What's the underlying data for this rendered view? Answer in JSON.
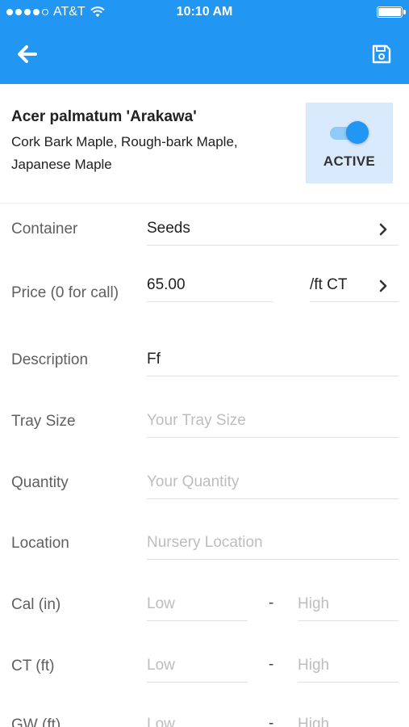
{
  "status_bar": {
    "carrier": "AT&T",
    "time": "10:10 AM"
  },
  "app_bar": {
    "back_icon": "back-arrow-icon",
    "save_icon": "floppy-save-icon",
    "accent_color": "#2196F3"
  },
  "plant": {
    "scientific_name": "Acer palmatum 'Arakawa'",
    "common_names": "Cork Bark Maple, Rough-bark Maple, Japanese Maple",
    "active_label": "ACTIVE",
    "active": true
  },
  "form": {
    "container": {
      "label": "Container",
      "value": "Seeds"
    },
    "price": {
      "label": "Price (0 for call)",
      "value": "65.00",
      "unit": "/ft CT"
    },
    "description": {
      "label": "Description",
      "value": "Ff"
    },
    "tray_size": {
      "label": "Tray Size",
      "placeholder": "Your Tray Size"
    },
    "quantity": {
      "label": "Quantity",
      "placeholder": "Your Quantity"
    },
    "location": {
      "label": "Location",
      "placeholder": "Nursery Location"
    },
    "cal": {
      "label": "Cal (in)",
      "low_placeholder": "Low",
      "high_placeholder": "High",
      "separator": "-"
    },
    "ct": {
      "label": "CT (ft)",
      "low_placeholder": "Low",
      "high_placeholder": "High",
      "separator": "-"
    },
    "gw": {
      "label": "GW (ft)",
      "low_placeholder": "Low",
      "high_placeholder": "High",
      "separator": "-"
    }
  }
}
